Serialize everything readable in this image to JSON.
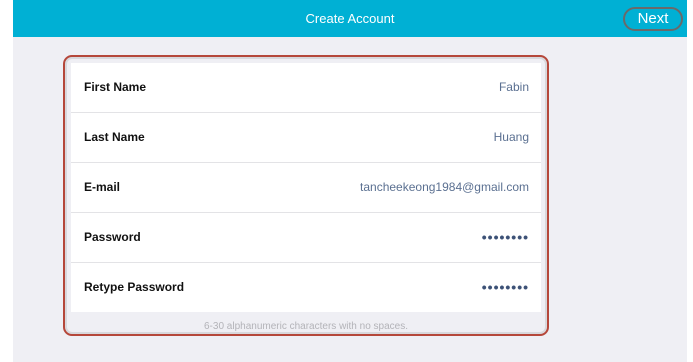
{
  "navbar": {
    "title": "Create Account",
    "next_label": "Next"
  },
  "form": {
    "rows": [
      {
        "label": "First Name",
        "value": "Fabin"
      },
      {
        "label": "Last Name",
        "value": "Huang"
      },
      {
        "label": "E-mail",
        "value": "tancheekeong1984@gmail.com"
      },
      {
        "label": "Password",
        "value": "••••••••"
      },
      {
        "label": "Retype Password",
        "value": "••••••••"
      }
    ],
    "hint": "6-30 alphanumeric characters with no spaces."
  },
  "colors": {
    "navbar_bg": "#00b0d4",
    "background": "#efeff4",
    "highlight_border": "#b5473a",
    "value_text": "#5b7091"
  }
}
